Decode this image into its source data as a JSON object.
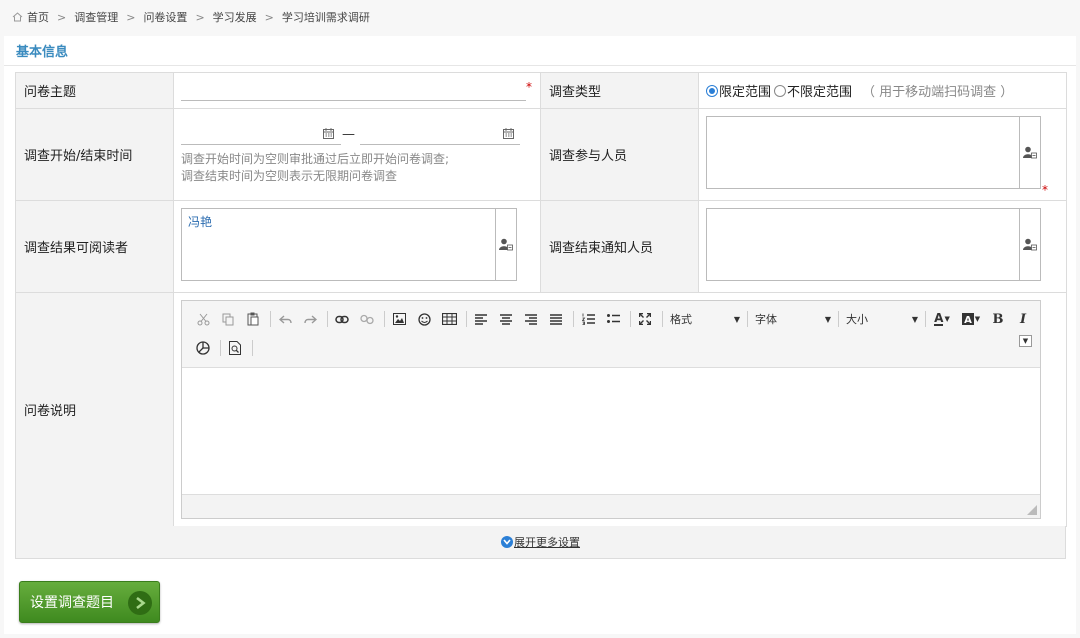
{
  "breadcrumb": {
    "items": [
      "首页",
      "调查管理",
      "问卷设置",
      "学习发展",
      "学习培训需求调研"
    ],
    "separator": ">"
  },
  "section": {
    "title": "基本信息"
  },
  "form": {
    "subject": {
      "label": "问卷主题",
      "value": "",
      "required_mark": "*"
    },
    "survey_type": {
      "label": "调查类型",
      "options": [
        {
          "label": "限定范围",
          "checked": true
        },
        {
          "label": "不限定范围",
          "checked": false
        }
      ],
      "hint": "（ 用于移动端扫码调查 ）"
    },
    "time": {
      "label": "调查开始/结束时间",
      "start": "",
      "end": "",
      "dash": "—",
      "hint1": "调查开始时间为空则审批通过后立即开始问卷调查;",
      "hint2": "调查结束时间为空则表示无限期问卷调查"
    },
    "participants": {
      "label": "调查参与人员",
      "value": "",
      "required_mark": "*"
    },
    "readers": {
      "label": "调查结果可阅读者",
      "value": "冯艳"
    },
    "notify": {
      "label": "调查结束通知人员",
      "value": ""
    },
    "description": {
      "label": "问卷说明",
      "toolbar": {
        "format": "格式",
        "font": "字体",
        "size": "大小",
        "bold": "B",
        "italic": "I",
        "font_color": "A"
      }
    }
  },
  "expand_link": "展开更多设置",
  "primary_button": "设置调查题目",
  "colors": {
    "accent": "#3a8bbf",
    "link": "#2b7fd6",
    "button": "#4f9a2b",
    "required": "#cc0000"
  }
}
